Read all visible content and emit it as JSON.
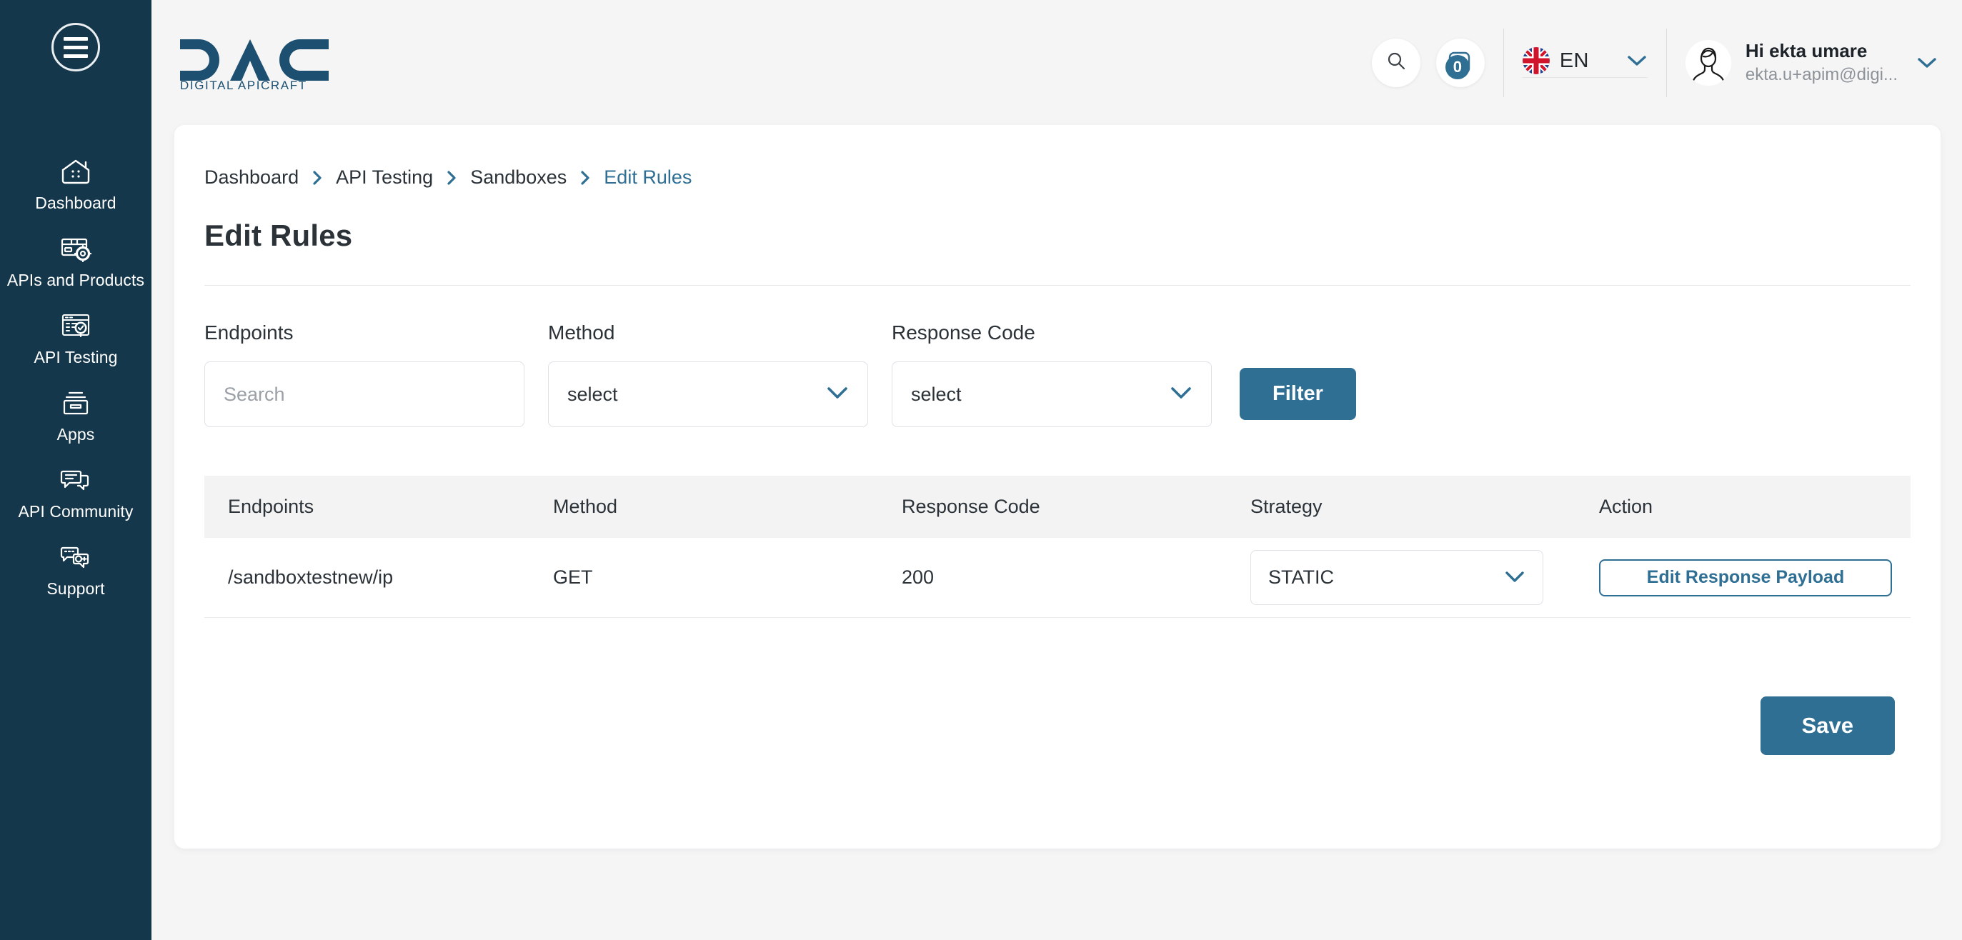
{
  "sidebar": {
    "menu_toggle": "menu-toggle",
    "items": [
      {
        "label": "Dashboard",
        "icon": "dashboard-home-icon"
      },
      {
        "label": "APIs and Products",
        "icon": "apis-products-box-icon"
      },
      {
        "label": "API Testing",
        "icon": "api-testing-checklist-icon"
      },
      {
        "label": "Apps",
        "icon": "apps-archive-box-icon"
      },
      {
        "label": "API Community",
        "icon": "community-chat-icon"
      },
      {
        "label": "Support",
        "icon": "support-headset-chat-icon"
      }
    ]
  },
  "header": {
    "logo_primary": "DAC",
    "logo_tagline": "DIGITAL APICRAFT",
    "search_icon": "search-icon",
    "notifications_icon": "tasks-checklist-icon",
    "notifications_count": "0",
    "language": {
      "code": "EN",
      "flag": "uk-flag-icon"
    },
    "user": {
      "greeting": "Hi ekta umare",
      "email": "ekta.u+apim@digi...",
      "avatar": "user-avatar-icon"
    }
  },
  "breadcrumb": {
    "items": [
      {
        "label": "Dashboard",
        "active": false
      },
      {
        "label": "API Testing",
        "active": false
      },
      {
        "label": "Sandboxes",
        "active": false
      },
      {
        "label": "Edit Rules",
        "active": true
      }
    ]
  },
  "page": {
    "title": "Edit Rules"
  },
  "filters": {
    "endpoints": {
      "label": "Endpoints",
      "placeholder": "Search",
      "value": ""
    },
    "method": {
      "label": "Method",
      "selected": "select"
    },
    "response_code": {
      "label": "Response Code",
      "selected": "select"
    },
    "filter_button": "Filter"
  },
  "table": {
    "columns": [
      "Endpoints",
      "Method",
      "Response Code",
      "Strategy",
      "Action"
    ],
    "rows": [
      {
        "endpoint": "/sandboxtestnew/ip",
        "method": "GET",
        "response_code": "200",
        "strategy": "STATIC",
        "action_label": "Edit Response Payload"
      }
    ]
  },
  "footer": {
    "save_label": "Save"
  },
  "colors": {
    "sidebar_bg": "#15374b",
    "accent": "#2f6f94",
    "page_bg": "#f5f5f6",
    "card_bg": "#ffffff",
    "table_header_bg": "#f3f3f4",
    "text_primary": "#2b3238",
    "text_muted": "#9aa0a6"
  }
}
